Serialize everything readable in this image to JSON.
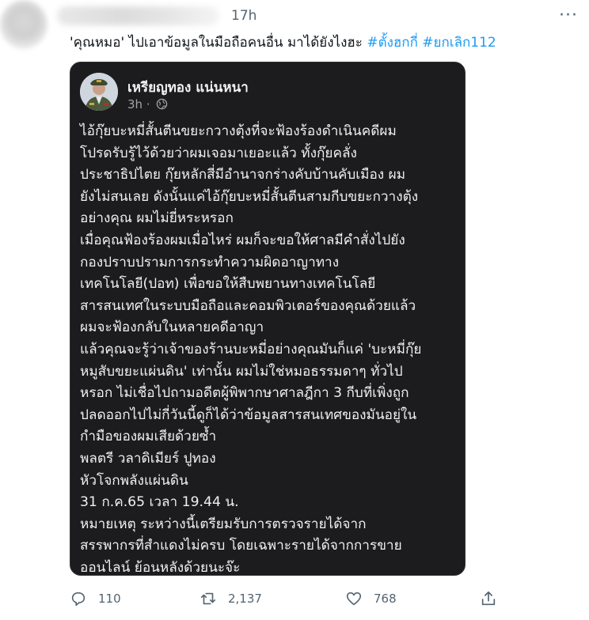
{
  "tweet": {
    "time": "17h",
    "more_label": "···",
    "text_prefix": "'คุณหมอ' ไปเอาข้อมูลในมือถือคนอื่น มาได้ยังไงฮะ",
    "hashtags": [
      "#ตั้งฮกกี่",
      "#ยกเลิก112"
    ]
  },
  "embedded": {
    "name": "เหรียญทอง แน่นหนา",
    "time": "3h ·",
    "body": "ไอ้กุ๊ยบะหมี่สั้นตีนขยะกวางตุ้งที่จะฟ้องร้องดำเนินคดีผม\nโปรดรับรู้ไว้ด้วยว่าผมเจอมาเยอะแล้ว ทั้งกุ๊ยคลั่ง\nประชาธิปไตย กุ๊ยหลักสี่มีอำนาจกร่างคับบ้านคับเมือง ผม\nยังไม่สนเลย ดังนั้นแค่ไอ้กุ๊ยบะหมี่สั้นตีนสามกีบขยะกวางตุ้ง\nอย่างคุณ ผมไม่ยี่หระหรอก\nเมื่อคุณฟ้องร้องผมเมื่อไหร่ ผมก็จะขอให้ศาลมีคำสั่งไปยัง\nกองปราบปรามการกระทำความผิดอาญาทาง\nเทคโนโลยี(ปอท) เพื่อขอให้สืบพยานทางเทคโนโลยี\nสารสนเทศในระบบมือถือและคอมพิวเตอร์ของคุณด้วยแล้ว\nผมจะฟ้องกลับในหลายคดีอาญา\nแล้วคุณจะรู้ว่าเจ้าของร้านบะหมี่อย่างคุณมันก็แค่ 'บะหมี่กุ๊ย\nหมูสับขยะแผ่นดิน' เท่านั้น ผมไม่ใช่หมอธรรมดาๆ ทั่วไป\nหรอก ไม่เชื่อไปถามอดีตผู้พิพากษาศาลฎีกา 3 กีบที่เพิ่งถูก\nปลดออกไปไม่กี่วันนี้ดูก็ได้ว่าข้อมูลสารสนเทศของมันอยู่ใน\nกำมือของผมเสียด้วยซ้ำ\nพลตรี วลาดิเมียร์ ปูทอง\nหัวโจกพลังแผ่นดิน\n31 ก.ค.65 เวลา 19.44 น.\nหมายเหตุ ระหว่างนี้เตรียมรับการตรวจรายได้จาก\nสรรพากรที่สำแดงไม่ครบ โดยเฉพาะรายได้จากการขาย\nออนไลน์ ย้อนหลังด้วยนะจ๊ะ"
  },
  "actions": {
    "replies": "110",
    "retweets": "2,137",
    "likes": "768"
  },
  "colors": {
    "link": "#1d9bf0",
    "muted": "#536471",
    "card_bg": "#1c1c1e"
  }
}
